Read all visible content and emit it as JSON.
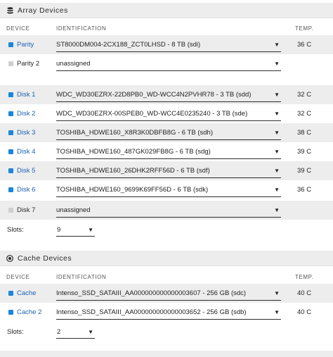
{
  "array": {
    "title": "Array Devices",
    "columns": {
      "device": "DEVICE",
      "identification": "IDENTIFICATION",
      "temp": "TEMP."
    },
    "rows": [
      {
        "name": "Parity",
        "active": true,
        "ident": "ST8000DM004-2CX188_ZCT0LHSD - 8 TB (sdi)",
        "temp": "36 C"
      },
      {
        "name": "Parity 2",
        "active": false,
        "ident": "unassigned",
        "temp": ""
      },
      {
        "name": "Disk 1",
        "active": true,
        "ident": "WDC_WD30EZRX-22D8PB0_WD-WCC4N2PVHR78 - 3 TB (sdd)",
        "temp": "32 C"
      },
      {
        "name": "Disk 2",
        "active": true,
        "ident": "WDC_WD30EZRX-00SPEB0_WD-WCC4E0235240 - 3 TB (sde)",
        "temp": "32 C"
      },
      {
        "name": "Disk 3",
        "active": true,
        "ident": "TOSHIBA_HDWE160_X8R3K0DBFB8G - 6 TB (sdh)",
        "temp": "38 C"
      },
      {
        "name": "Disk 4",
        "active": true,
        "ident": "TOSHIBA_HDWE160_487GK029FB8G - 6 TB (sdg)",
        "temp": "39 C"
      },
      {
        "name": "Disk 5",
        "active": true,
        "ident": "TOSHIBA_HDWE160_26DHK2RFF56D - 6 TB (sdf)",
        "temp": "39 C"
      },
      {
        "name": "Disk 6",
        "active": true,
        "ident": "TOSHIBA_HDWE160_9699K69FF56D - 6 TB (sdk)",
        "temp": "36 C"
      },
      {
        "name": "Disk 7",
        "active": false,
        "ident": "unassigned",
        "temp": ""
      }
    ],
    "slots_label": "Slots:",
    "slots_value": "9"
  },
  "cache": {
    "title": "Cache Devices",
    "columns": {
      "device": "DEVICE",
      "identification": "IDENTIFICATION",
      "temp": "TEMP."
    },
    "rows": [
      {
        "name": "Cache",
        "active": true,
        "ident": "Intenso_SSD_SATAIII_AA000000000000003607 - 256 GB (sdc)",
        "temp": "40 C"
      },
      {
        "name": "Cache 2",
        "active": true,
        "ident": "Intenso_SSD_SATAIII_AA000000000000003652 - 256 GB (sdb)",
        "temp": "40 C"
      }
    ],
    "slots_label": "Slots:",
    "slots_value": "2"
  },
  "icons": {
    "array": "database-icon",
    "cache": "cache-disc-icon",
    "dropdown": "caret-down-icon"
  },
  "colors": {
    "accent": "#1b86d8",
    "link": "#1b64b4",
    "inactive": "#cfcfcf",
    "header_bg": "#ededed"
  }
}
